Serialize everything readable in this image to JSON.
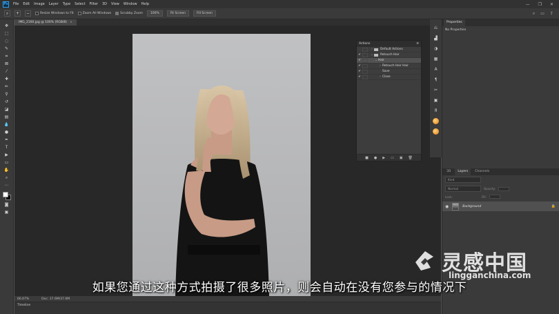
{
  "app": {
    "logo_text": "Ps",
    "menu": [
      "File",
      "Edit",
      "Image",
      "Layer",
      "Type",
      "Select",
      "Filter",
      "3D",
      "View",
      "Window",
      "Help"
    ],
    "window_controls": [
      "—",
      "❐",
      "✕"
    ]
  },
  "options_bar": {
    "resize_windows_label": "Resize Windows to Fit",
    "zoom_all_label": "Zoom All Windows",
    "scrubby_zoom_label": "Scrubby Zoom",
    "zoom_value": "100%",
    "fit_screen_label": "Fit Screen",
    "fill_screen_label": "Fill Screen"
  },
  "document": {
    "tab_title": "IMG_2160.jpg @ 100% (RGB/8)"
  },
  "status": {
    "zoom": "66.67%",
    "doc_size": "Doc: 37.6M/37.6M"
  },
  "timeline": {
    "label": "Timeline"
  },
  "actions_panel": {
    "title": "Actions",
    "rows": [
      {
        "check": "",
        "name": "Default Actions",
        "kind": "set",
        "indent": 0
      },
      {
        "check": "✔",
        "name": "Retouch Hair",
        "kind": "set",
        "indent": 0
      },
      {
        "check": "✔",
        "name": "Hair",
        "kind": "action",
        "indent": 1
      },
      {
        "check": "✔",
        "name": "Retouch Hair Hair",
        "kind": "step",
        "indent": 2
      },
      {
        "check": "✔",
        "name": "Save",
        "kind": "step",
        "indent": 2
      },
      {
        "check": "✔",
        "name": "Close",
        "kind": "step",
        "indent": 2
      }
    ],
    "footer_icons": [
      "■",
      "●",
      "▶",
      "▭",
      "▣",
      "🗑"
    ]
  },
  "properties_panel": {
    "tab": "Properties",
    "body": "No Properties"
  },
  "layers_panel": {
    "tabs": [
      "3D",
      "Layers",
      "Channels"
    ],
    "kind_placeholder": "Kind",
    "blend_mode": "Normal",
    "opacity_label": "Opacity:",
    "lock_label": "Lock:",
    "fill_label": "Fill:",
    "layer_name": "Background"
  },
  "subtitle": "如果您通过这种方式拍摄了很多照片，则会自动在没有您参与的情况下",
  "watermark": {
    "cn": "灵感中国",
    "en": "lingganchina.com"
  }
}
